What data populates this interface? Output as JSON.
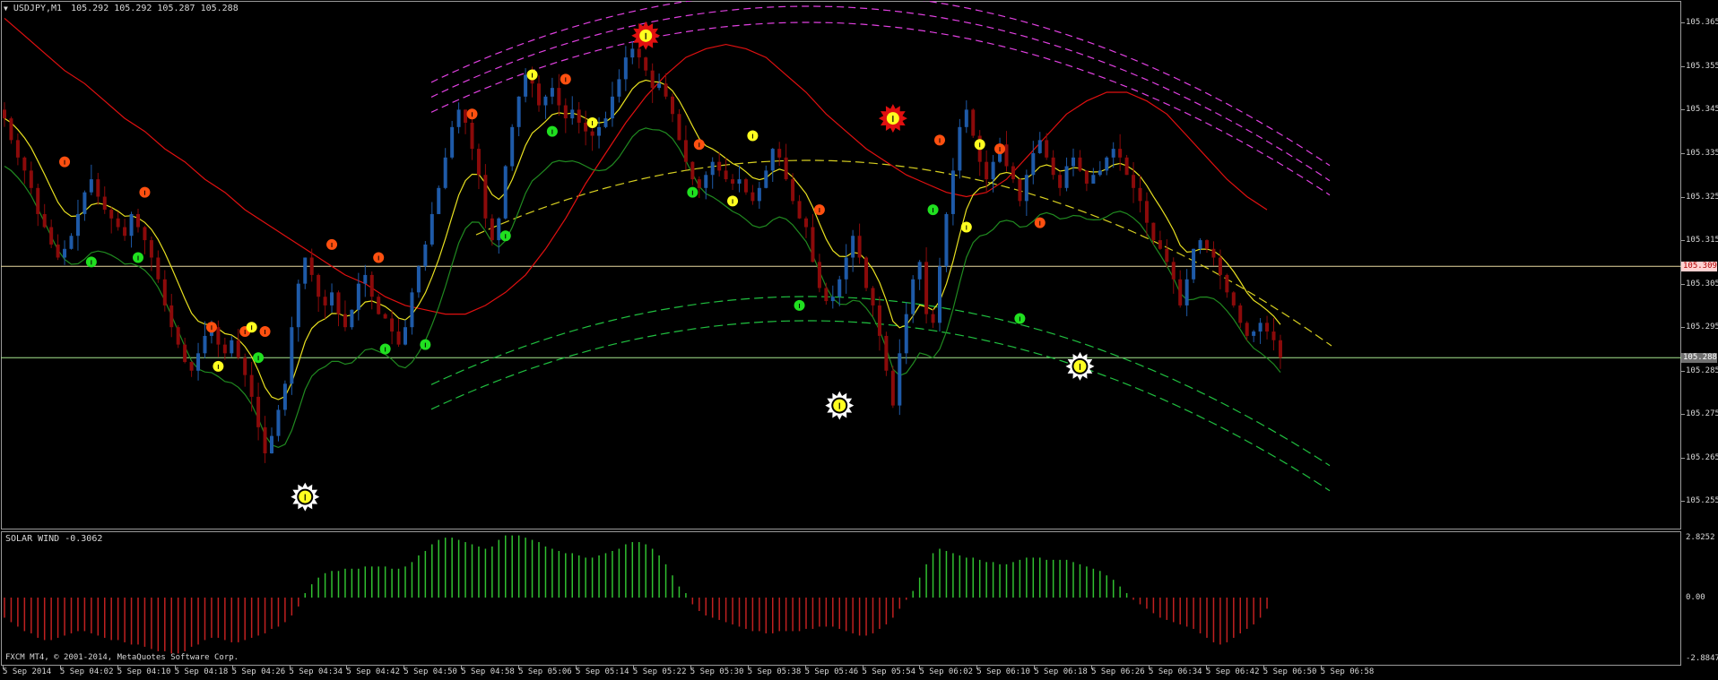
{
  "window": {
    "symbol_title": "USDJPY,M1",
    "ohlc": "105.292 105.292 105.287 105.288",
    "copyright": "FXCM MT4, © 2001-2014, MetaQuotes Software Corp."
  },
  "indicator": {
    "label": "SOLAR WIND -0.3062",
    "scale_top": "2.8252",
    "scale_zero": "0.00",
    "scale_bottom": "-2.8847",
    "max": 2.8252,
    "min": -2.8847
  },
  "price_axis": {
    "labels": [
      "105.365",
      "105.355",
      "105.345",
      "105.335",
      "105.325",
      "105.315",
      "105.305",
      "105.295",
      "105.285",
      "105.275",
      "105.265",
      "105.255"
    ],
    "min": 105.2485,
    "max": 105.37,
    "hline_upper": {
      "value": 105.309,
      "label": "105.309",
      "color": "#e8d9a0",
      "badge_bg": "#ffd0d0",
      "badge_fg": "#b00000"
    },
    "hline_lower": {
      "value": 105.288,
      "label": "105.288",
      "color": "#a8e890",
      "badge_bg": "#707070",
      "badge_fg": "#ffffff"
    }
  },
  "time_axis": {
    "labels": [
      "5 Sep 2014",
      "5 Sep 04:02",
      "5 Sep 04:10",
      "5 Sep 04:18",
      "5 Sep 04:26",
      "5 Sep 04:34",
      "5 Sep 04:42",
      "5 Sep 04:50",
      "5 Sep 04:58",
      "5 Sep 05:06",
      "5 Sep 05:14",
      "5 Sep 05:22",
      "5 Sep 05:30",
      "5 Sep 05:38",
      "5 Sep 05:46",
      "5 Sep 05:54",
      "5 Sep 06:02",
      "5 Sep 06:10",
      "5 Sep 06:18",
      "5 Sep 06:26",
      "5 Sep 06:34",
      "5 Sep 06:42",
      "5 Sep 06:50",
      "5 Sep 06:58"
    ]
  },
  "colors": {
    "bull": "#1e5aa8",
    "bear": "#8b0a0a",
    "doji": "#e0e0e0",
    "ma_red": "#e01010",
    "ma_yellow": "#e8e020",
    "ma_green": "#208a20",
    "band_magenta": "#e040e0",
    "band_yellow": "#d8d020",
    "band_green": "#20c040",
    "dot_orange": "#ff5010",
    "dot_yellow": "#ffff20",
    "dot_green": "#20e020",
    "hist_pos": "#30c030",
    "hist_neg": "#c02020"
  },
  "chart_data": {
    "type": "candlestick",
    "symbol": "USDJPY",
    "timeframe": "M1",
    "closes": [
      105.343,
      105.338,
      105.334,
      105.331,
      105.327,
      105.321,
      105.318,
      105.314,
      105.311,
      105.313,
      105.316,
      105.321,
      105.326,
      105.329,
      105.325,
      105.322,
      105.32,
      105.318,
      105.316,
      105.321,
      105.318,
      105.315,
      105.311,
      105.306,
      105.3,
      105.295,
      105.291,
      105.287,
      105.285,
      105.289,
      105.293,
      105.295,
      105.291,
      105.289,
      105.292,
      105.288,
      105.284,
      105.279,
      105.272,
      105.266,
      105.27,
      105.276,
      105.282,
      105.295,
      105.305,
      105.311,
      105.307,
      105.302,
      105.3,
      105.303,
      105.298,
      105.295,
      105.299,
      105.305,
      105.307,
      105.302,
      105.298,
      105.297,
      105.294,
      105.291,
      105.295,
      105.303,
      105.309,
      105.314,
      105.321,
      105.327,
      105.334,
      105.341,
      105.345,
      105.342,
      105.336,
      105.33,
      105.32,
      105.315,
      105.32,
      105.332,
      105.341,
      105.348,
      105.353,
      105.351,
      105.346,
      105.348,
      105.35,
      105.346,
      105.343,
      105.345,
      105.342,
      105.34,
      105.339,
      105.341,
      105.343,
      105.348,
      105.352,
      105.357,
      105.359,
      105.357,
      105.354,
      105.35,
      105.351,
      105.348,
      105.344,
      105.338,
      105.333,
      105.329,
      105.327,
      105.33,
      105.333,
      105.331,
      105.329,
      105.328,
      105.329,
      105.326,
      105.324,
      105.327,
      105.331,
      105.336,
      105.334,
      105.329,
      105.324,
      105.32,
      105.318,
      105.31,
      105.304,
      105.301,
      105.302,
      105.306,
      105.311,
      105.316,
      105.311,
      105.304,
      105.3,
      105.293,
      105.285,
      105.277,
      105.289,
      105.298,
      105.306,
      105.31,
      105.298,
      105.296,
      105.309,
      105.321,
      105.331,
      105.341,
      105.345,
      105.339,
      105.333,
      105.329,
      105.333,
      105.337,
      105.332,
      105.329,
      105.324,
      105.33,
      105.335,
      105.338,
      105.334,
      105.33,
      105.327,
      105.332,
      105.334,
      105.331,
      105.328,
      105.33,
      105.331,
      105.334,
      105.336,
      105.334,
      105.33,
      105.327,
      105.324,
      105.319,
      105.315,
      105.313,
      105.31,
      105.306,
      105.3,
      105.306,
      105.313,
      105.315,
      105.313,
      105.311,
      105.307,
      105.303,
      105.3,
      105.296,
      105.293,
      105.294,
      105.296,
      105.294,
      105.292,
      105.288
    ],
    "histogram": [
      -0.9,
      -1.1,
      -1.3,
      -1.5,
      -1.6,
      -1.8,
      -1.9,
      -1.9,
      -1.8,
      -1.7,
      -1.6,
      -1.5,
      -1.5,
      -1.6,
      -1.7,
      -1.8,
      -1.9,
      -1.9,
      -2.0,
      -2.1,
      -2.1,
      -2.2,
      -2.3,
      -2.4,
      -2.4,
      -2.5,
      -2.5,
      -2.4,
      -2.2,
      -2.1,
      -1.9,
      -1.8,
      -1.8,
      -1.9,
      -2.0,
      -2.0,
      -1.9,
      -1.8,
      -1.7,
      -1.6,
      -1.4,
      -1.3,
      -1.1,
      -0.8,
      -0.4,
      0.2,
      0.6,
      0.9,
      1.1,
      1.2,
      1.2,
      1.3,
      1.3,
      1.3,
      1.4,
      1.4,
      1.4,
      1.4,
      1.3,
      1.3,
      1.4,
      1.6,
      1.9,
      2.1,
      2.4,
      2.6,
      2.7,
      2.7,
      2.6,
      2.5,
      2.4,
      2.3,
      2.2,
      2.3,
      2.6,
      2.8,
      2.8,
      2.8,
      2.7,
      2.6,
      2.5,
      2.3,
      2.2,
      2.1,
      2.0,
      2.0,
      1.9,
      1.8,
      1.8,
      1.9,
      2.0,
      2.1,
      2.2,
      2.4,
      2.5,
      2.5,
      2.4,
      2.2,
      1.9,
      1.5,
      1.0,
      0.5,
      0.2,
      -0.3,
      -0.6,
      -0.8,
      -0.9,
      -1.0,
      -1.1,
      -1.2,
      -1.3,
      -1.4,
      -1.5,
      -1.5,
      -1.6,
      -1.6,
      -1.5,
      -1.5,
      -1.5,
      -1.5,
      -1.4,
      -1.4,
      -1.3,
      -1.3,
      -1.3,
      -1.4,
      -1.5,
      -1.6,
      -1.7,
      -1.7,
      -1.6,
      -1.4,
      -1.2,
      -0.9,
      -0.5,
      -0.1,
      0.3,
      0.9,
      1.5,
      2.0,
      2.2,
      2.1,
      2.0,
      1.9,
      1.8,
      1.8,
      1.7,
      1.6,
      1.6,
      1.5,
      1.5,
      1.6,
      1.7,
      1.8,
      1.8,
      1.8,
      1.7,
      1.7,
      1.7,
      1.7,
      1.6,
      1.5,
      1.4,
      1.3,
      1.2,
      1.0,
      0.8,
      0.5,
      0.2,
      -0.1,
      -0.3,
      -0.5,
      -0.7,
      -0.9,
      -1.0,
      -1.1,
      -1.2,
      -1.3,
      -1.4,
      -1.6,
      -1.8,
      -2.0,
      -2.1,
      -2.0,
      -1.8,
      -1.6,
      -1.4,
      -1.2,
      -0.9,
      -0.5
    ],
    "ma_red": [
      105.366,
      105.362,
      105.358,
      105.354,
      105.351,
      105.347,
      105.343,
      105.34,
      105.336,
      105.333,
      105.329,
      105.326,
      105.322,
      105.319,
      105.316,
      105.313,
      105.31,
      105.307,
      105.305,
      105.302,
      105.3,
      105.299,
      105.298,
      105.298,
      105.3,
      105.303,
      105.307,
      105.313,
      105.32,
      105.328,
      105.335,
      105.342,
      105.348,
      105.353,
      105.357,
      105.359,
      105.36,
      105.359,
      105.357,
      105.353,
      105.349,
      105.344,
      105.34,
      105.336,
      105.333,
      105.33,
      105.328,
      105.326,
      105.325,
      105.326,
      105.329,
      105.334,
      105.339,
      105.344,
      105.347,
      105.349,
      105.349,
      105.347,
      105.344,
      105.339,
      105.334,
      105.329,
      105.325,
      105.322
    ],
    "markers": [
      {
        "i": 9,
        "kind": "orange",
        "price": 105.333
      },
      {
        "i": 13,
        "kind": "green",
        "price": 105.31
      },
      {
        "i": 20,
        "kind": "green",
        "price": 105.311
      },
      {
        "i": 21,
        "kind": "orange",
        "price": 105.326
      },
      {
        "i": 31,
        "kind": "orange",
        "price": 105.295
      },
      {
        "i": 32,
        "kind": "yellow",
        "price": 105.286
      },
      {
        "i": 36,
        "kind": "orange",
        "price": 105.294
      },
      {
        "i": 37,
        "kind": "yellow",
        "price": 105.295
      },
      {
        "i": 38,
        "kind": "green",
        "price": 105.288
      },
      {
        "i": 39,
        "kind": "orange",
        "price": 105.294
      },
      {
        "i": 45,
        "kind": "sun-white",
        "price": 105.256
      },
      {
        "i": 49,
        "kind": "orange",
        "price": 105.314
      },
      {
        "i": 56,
        "kind": "orange",
        "price": 105.311
      },
      {
        "i": 57,
        "kind": "green",
        "price": 105.29
      },
      {
        "i": 63,
        "kind": "green",
        "price": 105.291
      },
      {
        "i": 70,
        "kind": "orange",
        "price": 105.344
      },
      {
        "i": 75,
        "kind": "green",
        "price": 105.316
      },
      {
        "i": 79,
        "kind": "yellow",
        "price": 105.353
      },
      {
        "i": 82,
        "kind": "green",
        "price": 105.34
      },
      {
        "i": 84,
        "kind": "orange",
        "price": 105.352
      },
      {
        "i": 88,
        "kind": "yellow",
        "price": 105.342
      },
      {
        "i": 96,
        "kind": "sun-red",
        "price": 105.362
      },
      {
        "i": 103,
        "kind": "green",
        "price": 105.326
      },
      {
        "i": 104,
        "kind": "orange",
        "price": 105.337
      },
      {
        "i": 109,
        "kind": "yellow",
        "price": 105.324
      },
      {
        "i": 112,
        "kind": "yellow",
        "price": 105.339
      },
      {
        "i": 119,
        "kind": "green",
        "price": 105.3
      },
      {
        "i": 122,
        "kind": "orange",
        "price": 105.322
      },
      {
        "i": 125,
        "kind": "sun-white",
        "price": 105.277
      },
      {
        "i": 133,
        "kind": "sun-red",
        "price": 105.343
      },
      {
        "i": 139,
        "kind": "green",
        "price": 105.322
      },
      {
        "i": 140,
        "kind": "orange",
        "price": 105.338
      },
      {
        "i": 144,
        "kind": "yellow",
        "price": 105.318
      },
      {
        "i": 146,
        "kind": "yellow",
        "price": 105.337
      },
      {
        "i": 149,
        "kind": "orange",
        "price": 105.336
      },
      {
        "i": 152,
        "kind": "green",
        "price": 105.297
      },
      {
        "i": 155,
        "kind": "orange",
        "price": 105.319
      },
      {
        "i": 161,
        "kind": "sun-white",
        "price": 105.286
      }
    ]
  }
}
